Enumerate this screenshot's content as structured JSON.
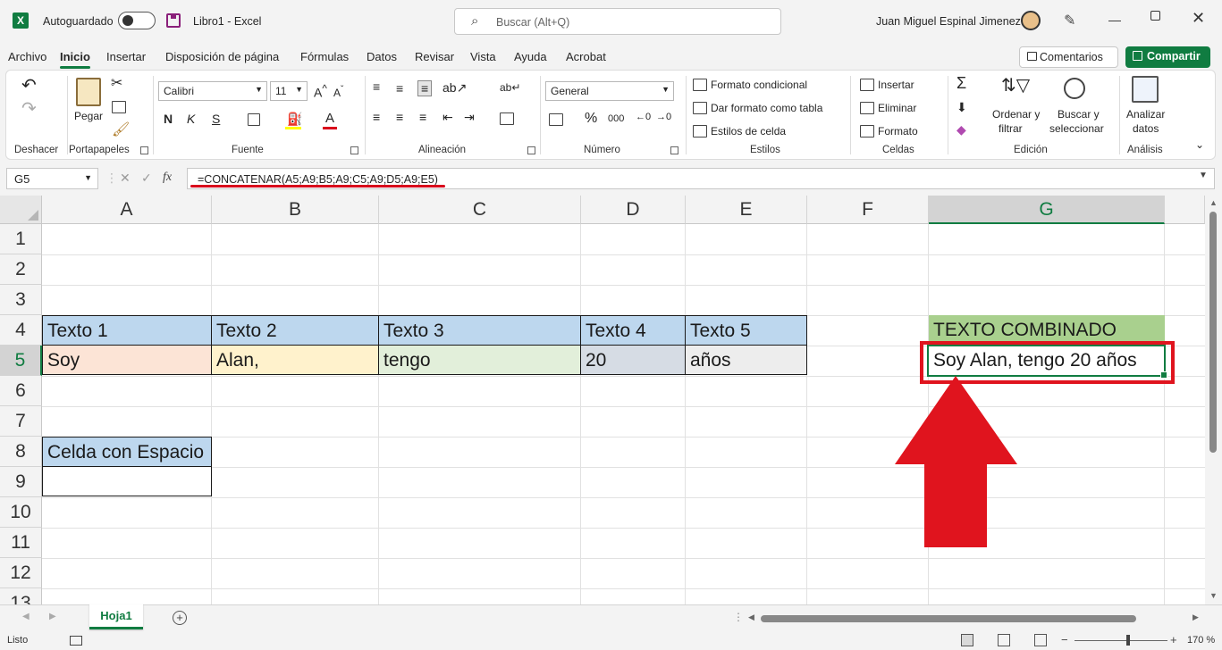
{
  "titlebar": {
    "autosave_label": "Autoguardado",
    "document_title": "Libro1  -  Excel",
    "search_placeholder": "Buscar (Alt+Q)",
    "user_name": "Juan Miguel Espinal Jimenez"
  },
  "menu": {
    "tabs": [
      "Archivo",
      "Inicio",
      "Insertar",
      "Disposición de página",
      "Fórmulas",
      "Datos",
      "Revisar",
      "Vista",
      "Ayuda",
      "Acrobat"
    ],
    "active": "Inicio",
    "comments_label": "Comentarios",
    "share_label": "Compartir"
  },
  "ribbon": {
    "groups": {
      "undo": "Deshacer",
      "clipboard": "Portapapeles",
      "font": "Fuente",
      "alignment": "Alineación",
      "number": "Número",
      "styles": "Estilos",
      "cells": "Celdas",
      "editing": "Edición",
      "analysis": "Análisis"
    },
    "paste_label": "Pegar",
    "font_name": "Calibri",
    "font_size": "11",
    "bold": "N",
    "italic": "K",
    "underline": "S",
    "font_color_letter": "A",
    "number_format": "General",
    "currency_symbol": "%",
    "decimal_symbol": "000",
    "conditional_format": "Formato condicional",
    "format_as_table": "Dar formato como tabla",
    "cell_styles": "Estilos de celda",
    "insert": "Insertar",
    "delete": "Eliminar",
    "format": "Formato",
    "sort_filter_1": "Ordenar y",
    "sort_filter_2": "filtrar",
    "find_select_1": "Buscar y",
    "find_select_2": "seleccionar",
    "analyze_1": "Analizar",
    "analyze_2": "datos"
  },
  "formula_bar": {
    "name_box": "G5",
    "fx": "fx",
    "formula": "=CONCATENAR(A5;A9;B5;A9;C5;A9;D5;A9;E5)"
  },
  "grid": {
    "columns": [
      "A",
      "B",
      "C",
      "D",
      "E",
      "F",
      "G"
    ],
    "rows": [
      "1",
      "2",
      "3",
      "4",
      "5",
      "6",
      "7",
      "8",
      "9",
      "10",
      "11",
      "12",
      "13"
    ],
    "selected_column": "G",
    "selected_row": "5",
    "cells": {
      "A4": "Texto 1",
      "B4": "Texto 2",
      "C4": "Texto 3",
      "D4": "Texto 4",
      "E4": "Texto 5",
      "A5": "Soy",
      "B5": "Alan,",
      "C5": "tengo",
      "D5": "20",
      "E5": "años",
      "A8": "Celda con Espacio",
      "G4": "TEXTO COMBINADO",
      "G5": "Soy  Alan, tengo 20 años"
    },
    "colors": {
      "header_blue": "#bdd7ee",
      "A5": "#fce4d6",
      "B5": "#fff2cc",
      "C5": "#e2efda",
      "D5": "#d6dce4",
      "E5": "#ededed",
      "G4": "#a9d08e",
      "highlight": "#e0141e"
    }
  },
  "sheets": {
    "tabs": [
      "Hoja1"
    ],
    "active": "Hoja1"
  },
  "status": {
    "mode": "Listo",
    "zoom": "170 %"
  }
}
